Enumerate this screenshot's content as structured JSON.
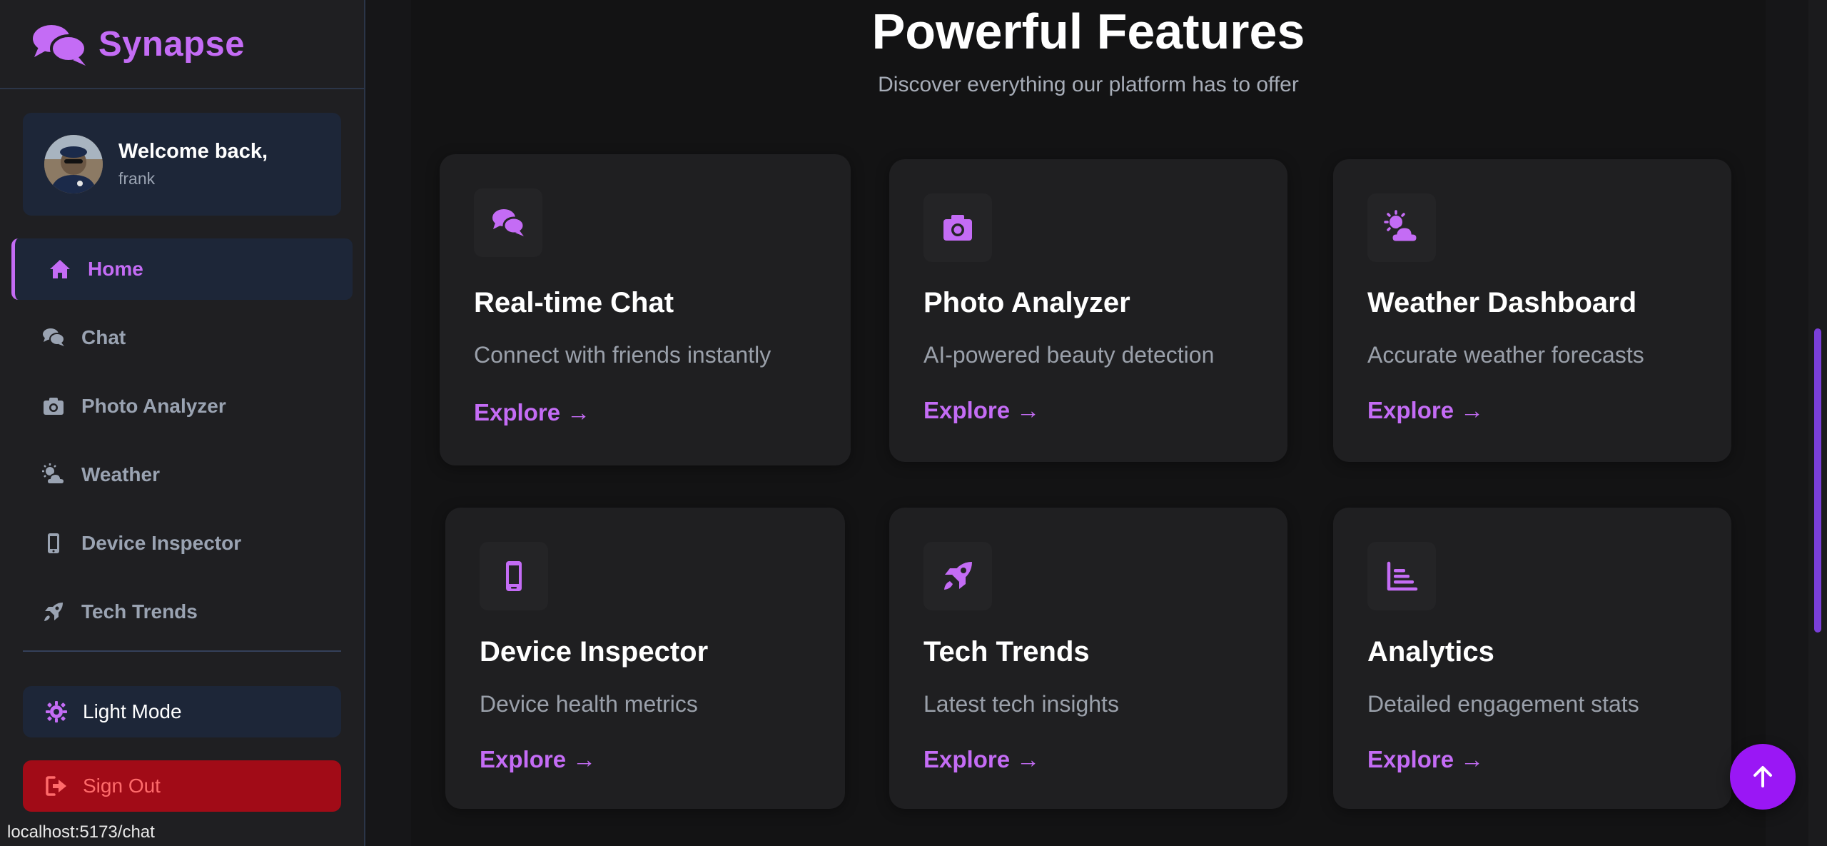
{
  "brand": {
    "name": "Synapse",
    "icon": "comments-icon",
    "accent": "#c46cf5"
  },
  "welcome": {
    "title": "Welcome back,",
    "username": "frank"
  },
  "nav": {
    "items": [
      {
        "label": "Home",
        "icon": "home-icon",
        "active": true
      },
      {
        "label": "Chat",
        "icon": "comments-icon",
        "active": false
      },
      {
        "label": "Photo Analyzer",
        "icon": "camera-icon",
        "active": false
      },
      {
        "label": "Weather",
        "icon": "cloud-sun-icon",
        "active": false
      },
      {
        "label": "Device Inspector",
        "icon": "mobile-icon",
        "active": false
      },
      {
        "label": "Tech Trends",
        "icon": "rocket-icon",
        "active": false
      }
    ]
  },
  "actions": {
    "light_mode": "Light Mode",
    "sign_out": "Sign Out"
  },
  "status_bar": {
    "url": "localhost:5173/chat"
  },
  "features": {
    "title": "Powerful Features",
    "subtitle": "Discover everything our platform has to offer",
    "cards": [
      {
        "title": "Real-time Chat",
        "description": "Connect with friends instantly",
        "link": "Explore →",
        "icon": "comments-icon"
      },
      {
        "title": "Photo Analyzer",
        "description": "AI-powered beauty detection",
        "link": "Explore →",
        "icon": "camera-icon"
      },
      {
        "title": "Weather Dashboard",
        "description": "Accurate weather forecasts",
        "link": "Explore →",
        "icon": "cloud-sun-icon"
      },
      {
        "title": "Device Inspector",
        "description": "Device health metrics",
        "link": "Explore →",
        "icon": "mobile-icon"
      },
      {
        "title": "Tech Trends",
        "description": "Latest tech insights",
        "link": "Explore →",
        "icon": "rocket-icon"
      },
      {
        "title": "Analytics",
        "description": "Detailed engagement stats",
        "link": "Explore →",
        "icon": "chart-bar-icon"
      }
    ]
  },
  "colors": {
    "accent": "#c46cf5",
    "sidebar_bg": "#1f1f22",
    "card_bg": "#1f1f21",
    "sign_out_bg": "#a10b17",
    "fab_bg": "#9a17f5"
  },
  "scroll_to_top": {
    "icon": "arrow-up-icon"
  }
}
